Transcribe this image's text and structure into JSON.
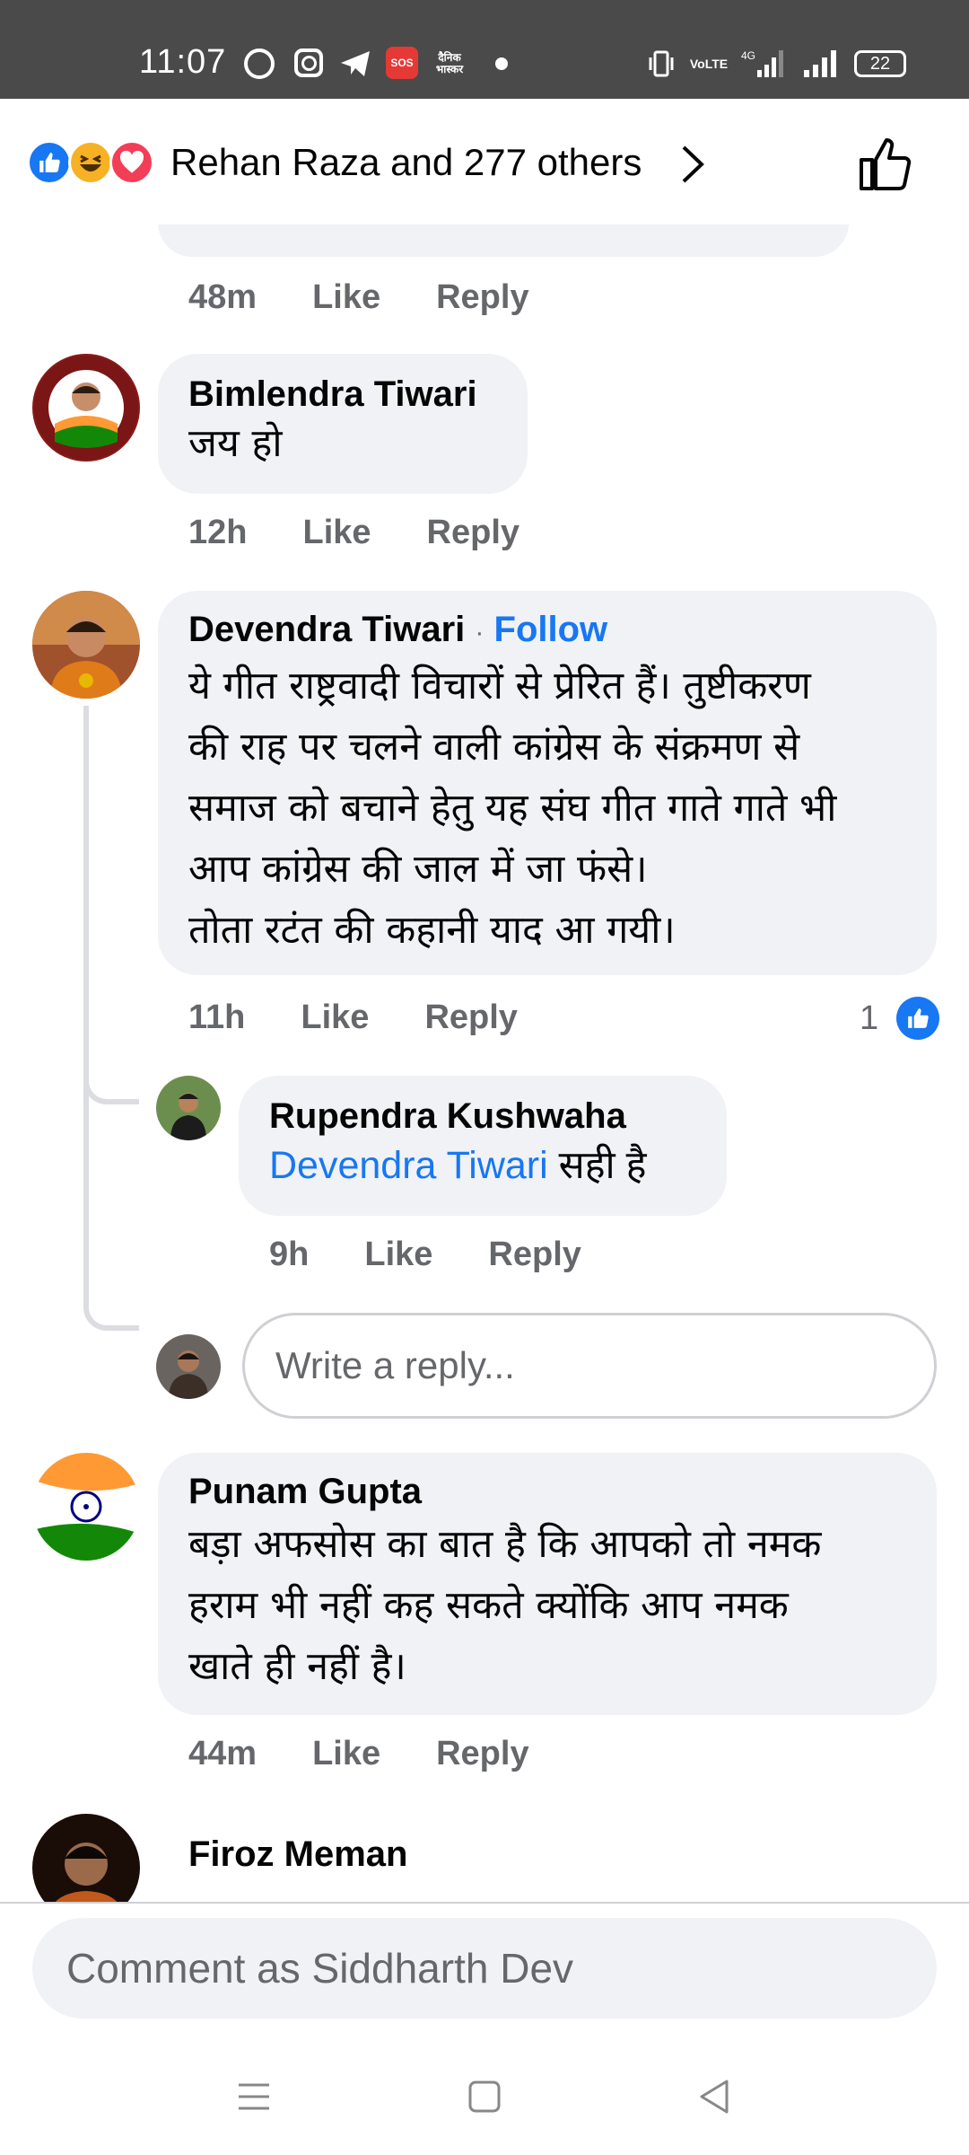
{
  "status_bar": {
    "time": "11:07",
    "sos": "SOS",
    "news_app": "दैनिक भास्कर",
    "volte": "VoLTE",
    "network": "4G",
    "battery": "22"
  },
  "header": {
    "reactions": [
      "like-reaction",
      "haha-reaction",
      "love-reaction"
    ],
    "reactors_text": "Rehan Raza and 277 others"
  },
  "comments": {
    "c0": {
      "time": "48m",
      "like": "Like",
      "reply": "Reply"
    },
    "c1": {
      "author": "Bimlendra Tiwari",
      "text": "जय हो",
      "time": "12h",
      "like": "Like",
      "reply": "Reply"
    },
    "c2": {
      "author": "Devendra Tiwari",
      "separator": "·",
      "follow": "Follow",
      "lines": [
        "ये गीत राष्ट्रवादी विचारों से प्रेरित हैं। तुष्टीकरण",
        "की राह पर चलने वाली कांग्रेस के संक्रमण से",
        "समाज को बचाने हेतु यह संघ गीत गाते गाते भी",
        "आप कांग्रेस की जाल में जा फंसे।",
        "तोता रटंत की कहानी याद आ गयी।"
      ],
      "time": "11h",
      "like": "Like",
      "reply": "Reply",
      "like_count": "1"
    },
    "r1": {
      "author": "Rupendra Kushwaha",
      "mention": "Devendra Tiwari",
      "text": " सही है",
      "time": "9h",
      "like": "Like",
      "reply": "Reply"
    },
    "reply_placeholder": "Write a reply...",
    "c3": {
      "author": "Punam Gupta",
      "lines": [
        "बड़ा अफसोस का बात है कि आपको तो नमक",
        "हराम भी नहीं कह सकते क्योंकि आप नमक",
        "खाते ही नहीं है।"
      ],
      "time": "44m",
      "like": "Like",
      "reply": "Reply"
    },
    "c4": {
      "author": "Firoz Meman"
    }
  },
  "comment_input": {
    "placeholder": "Comment as Siddharth Dev"
  },
  "colors": {
    "accent": "#1877f2",
    "bubble": "#f0f2f5",
    "meta": "#65676b",
    "statusbar": "#4a4a4a"
  }
}
